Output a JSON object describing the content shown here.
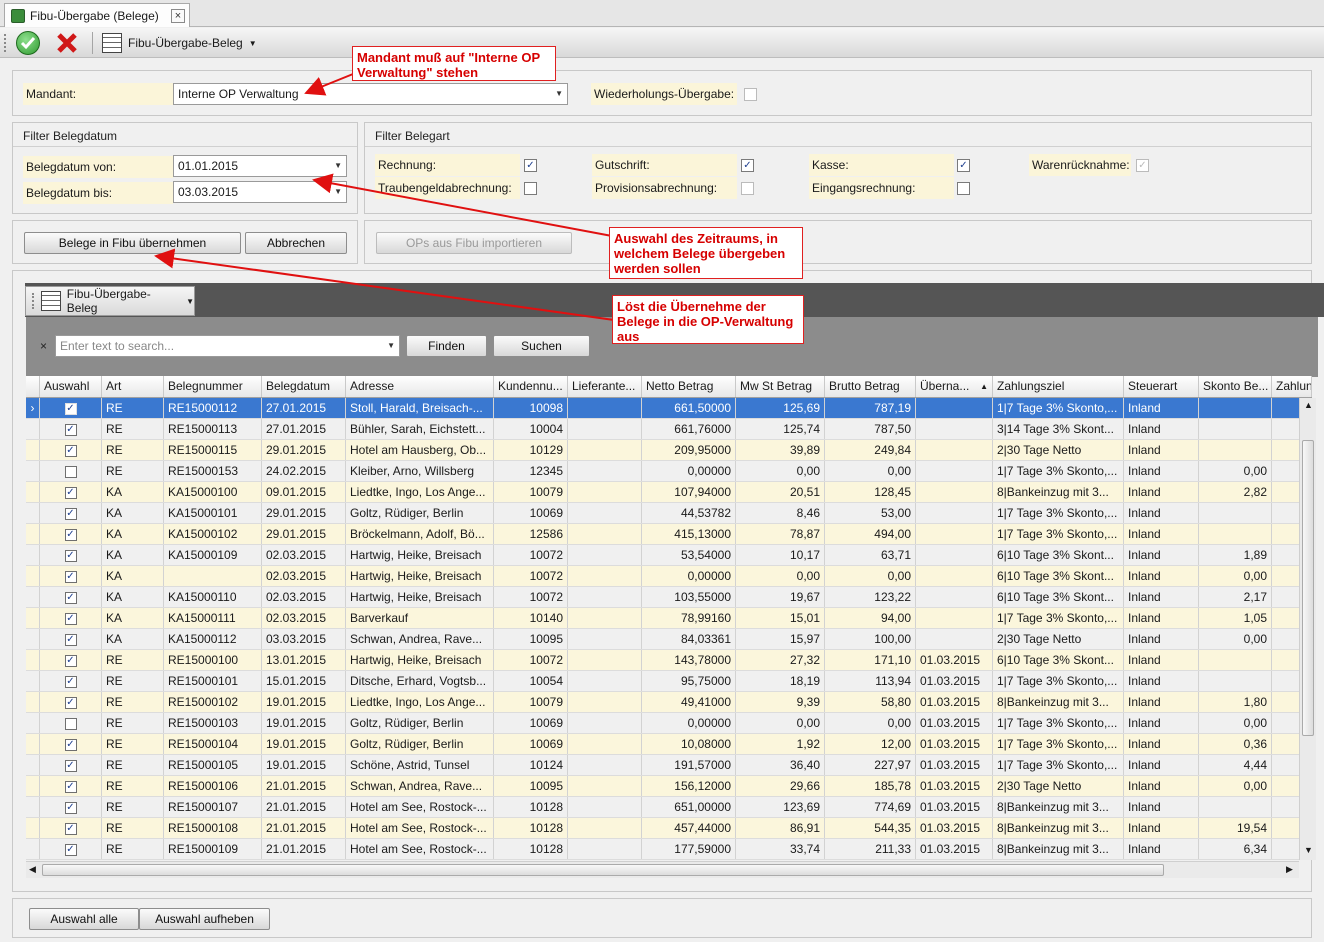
{
  "tab": {
    "title": "Fibu-Übergabe (Belege)",
    "close": "×"
  },
  "toolbar": {
    "report_label": "Fibu-Übergabe-Beleg"
  },
  "mandant": {
    "label": "Mandant:",
    "value": "Interne OP Verwaltung",
    "repeat_label": "Wiederholungs-Übergabe:"
  },
  "filter_date": {
    "title": "Filter Belegdatum",
    "from_label": "Belegdatum von:",
    "from_value": "01.01.2015",
    "to_label": "Belegdatum bis:",
    "to_value": "03.03.2015"
  },
  "filter_type": {
    "title": "Filter Belegart",
    "items": [
      {
        "label": "Rechnung:",
        "checked": true,
        "enabled": true
      },
      {
        "label": "Gutschrift:",
        "checked": true,
        "enabled": true
      },
      {
        "label": "Kasse:",
        "checked": true,
        "enabled": true
      },
      {
        "label": "Warenrücknahme:",
        "checked": true,
        "enabled": false
      },
      {
        "label": "Traubengeldabrechnung:",
        "checked": false,
        "enabled": true
      },
      {
        "label": "Provisionsabrechnung:",
        "checked": false,
        "enabled": false
      },
      {
        "label": "Eingangsrechnung:",
        "checked": false,
        "enabled": true
      }
    ]
  },
  "actions": {
    "take_over": "Belege in Fibu übernehmen",
    "cancel": "Abbrechen",
    "import": "OPs aus Fibu importieren"
  },
  "grid_toolbar": {
    "label": "Fibu-Übergabe-Beleg"
  },
  "search": {
    "placeholder": "Enter text to search...",
    "find": "Finden",
    "search": "Suchen"
  },
  "callouts": {
    "mandant": "Mandant muß auf \"Interne OP Verwaltung\" stehen",
    "period": "Auswahl des Zeitraums, in welchem Belege übergeben werden sollen",
    "takeover": "Löst die Übernehme der Belege in die OP-Verwaltung aus"
  },
  "columns": [
    "Auswahl",
    "Art",
    "Belegnummer",
    "Belegdatum",
    "Adresse",
    "Kundennu...",
    "Lieferante...",
    "Netto Betrag",
    "Mw St Betrag",
    "Brutto Betrag",
    "Überna...",
    "Zahlungsziel",
    "Steuerart",
    "Skonto Be...",
    "Zahlun"
  ],
  "rows": [
    {
      "checked": true,
      "art": "RE",
      "nr": "RE15000112",
      "datum": "27.01.2015",
      "adresse": "Stoll, Harald, Breisach-...",
      "kunde": "10098",
      "netto": "661,50000",
      "mwst": "125,69",
      "brutto": "787,19",
      "ueber": "",
      "ziel": "1|7 Tage 3% Skonto,...",
      "steuer": "Inland",
      "skonto": ""
    },
    {
      "checked": true,
      "art": "RE",
      "nr": "RE15000113",
      "datum": "27.01.2015",
      "adresse": "Bühler, Sarah, Eichstett...",
      "kunde": "10004",
      "netto": "661,76000",
      "mwst": "125,74",
      "brutto": "787,50",
      "ueber": "",
      "ziel": "3|14 Tage 3% Skont...",
      "steuer": "Inland",
      "skonto": ""
    },
    {
      "checked": true,
      "art": "RE",
      "nr": "RE15000115",
      "datum": "29.01.2015",
      "adresse": "Hotel am Hausberg, Ob...",
      "kunde": "10129",
      "netto": "209,95000",
      "mwst": "39,89",
      "brutto": "249,84",
      "ueber": "",
      "ziel": "2|30 Tage Netto",
      "steuer": "Inland",
      "skonto": ""
    },
    {
      "checked": false,
      "art": "RE",
      "nr": "RE15000153",
      "datum": "24.02.2015",
      "adresse": "Kleiber, Arno, Willsberg",
      "kunde": "12345",
      "netto": "0,00000",
      "mwst": "0,00",
      "brutto": "0,00",
      "ueber": "",
      "ziel": "1|7 Tage 3% Skonto,...",
      "steuer": "Inland",
      "skonto": "0,00"
    },
    {
      "checked": true,
      "art": "KA",
      "nr": "KA15000100",
      "datum": "09.01.2015",
      "adresse": "Liedtke, Ingo, Los Ange...",
      "kunde": "10079",
      "netto": "107,94000",
      "mwst": "20,51",
      "brutto": "128,45",
      "ueber": "",
      "ziel": "8|Bankeinzug mit 3...",
      "steuer": "Inland",
      "skonto": "2,82"
    },
    {
      "checked": true,
      "art": "KA",
      "nr": "KA15000101",
      "datum": "29.01.2015",
      "adresse": "Goltz, Rüdiger, Berlin",
      "kunde": "10069",
      "netto": "44,53782",
      "mwst": "8,46",
      "brutto": "53,00",
      "ueber": "",
      "ziel": "1|7 Tage 3% Skonto,...",
      "steuer": "Inland",
      "skonto": ""
    },
    {
      "checked": true,
      "art": "KA",
      "nr": "KA15000102",
      "datum": "29.01.2015",
      "adresse": "Bröckelmann, Adolf, Bö...",
      "kunde": "12586",
      "netto": "415,13000",
      "mwst": "78,87",
      "brutto": "494,00",
      "ueber": "",
      "ziel": "1|7 Tage 3% Skonto,...",
      "steuer": "Inland",
      "skonto": ""
    },
    {
      "checked": true,
      "art": "KA",
      "nr": "KA15000109",
      "datum": "02.03.2015",
      "adresse": "Hartwig, Heike, Breisach",
      "kunde": "10072",
      "netto": "53,54000",
      "mwst": "10,17",
      "brutto": "63,71",
      "ueber": "",
      "ziel": "6|10 Tage 3% Skont...",
      "steuer": "Inland",
      "skonto": "1,89"
    },
    {
      "checked": true,
      "art": "KA",
      "nr": "",
      "datum": "02.03.2015",
      "adresse": "Hartwig, Heike, Breisach",
      "kunde": "10072",
      "netto": "0,00000",
      "mwst": "0,00",
      "brutto": "0,00",
      "ueber": "",
      "ziel": "6|10 Tage 3% Skont...",
      "steuer": "Inland",
      "skonto": "0,00"
    },
    {
      "checked": true,
      "art": "KA",
      "nr": "KA15000110",
      "datum": "02.03.2015",
      "adresse": "Hartwig, Heike, Breisach",
      "kunde": "10072",
      "netto": "103,55000",
      "mwst": "19,67",
      "brutto": "123,22",
      "ueber": "",
      "ziel": "6|10 Tage 3% Skont...",
      "steuer": "Inland",
      "skonto": "2,17"
    },
    {
      "checked": true,
      "art": "KA",
      "nr": "KA15000111",
      "datum": "02.03.2015",
      "adresse": "Barverkauf",
      "kunde": "10140",
      "netto": "78,99160",
      "mwst": "15,01",
      "brutto": "94,00",
      "ueber": "",
      "ziel": "1|7 Tage 3% Skonto,...",
      "steuer": "Inland",
      "skonto": "1,05"
    },
    {
      "checked": true,
      "art": "KA",
      "nr": "KA15000112",
      "datum": "03.03.2015",
      "adresse": "Schwan, Andrea, Rave...",
      "kunde": "10095",
      "netto": "84,03361",
      "mwst": "15,97",
      "brutto": "100,00",
      "ueber": "",
      "ziel": "2|30 Tage Netto",
      "steuer": "Inland",
      "skonto": "0,00"
    },
    {
      "checked": true,
      "art": "RE",
      "nr": "RE15000100",
      "datum": "13.01.2015",
      "adresse": "Hartwig, Heike, Breisach",
      "kunde": "10072",
      "netto": "143,78000",
      "mwst": "27,32",
      "brutto": "171,10",
      "ueber": "01.03.2015",
      "ziel": "6|10 Tage 3% Skont...",
      "steuer": "Inland",
      "skonto": ""
    },
    {
      "checked": true,
      "art": "RE",
      "nr": "RE15000101",
      "datum": "15.01.2015",
      "adresse": "Ditsche, Erhard, Vogtsb...",
      "kunde": "10054",
      "netto": "95,75000",
      "mwst": "18,19",
      "brutto": "113,94",
      "ueber": "01.03.2015",
      "ziel": "1|7 Tage 3% Skonto,...",
      "steuer": "Inland",
      "skonto": ""
    },
    {
      "checked": true,
      "art": "RE",
      "nr": "RE15000102",
      "datum": "19.01.2015",
      "adresse": "Liedtke, Ingo, Los Ange...",
      "kunde": "10079",
      "netto": "49,41000",
      "mwst": "9,39",
      "brutto": "58,80",
      "ueber": "01.03.2015",
      "ziel": "8|Bankeinzug mit 3...",
      "steuer": "Inland",
      "skonto": "1,80"
    },
    {
      "checked": false,
      "art": "RE",
      "nr": "RE15000103",
      "datum": "19.01.2015",
      "adresse": "Goltz, Rüdiger, Berlin",
      "kunde": "10069",
      "netto": "0,00000",
      "mwst": "0,00",
      "brutto": "0,00",
      "ueber": "01.03.2015",
      "ziel": "1|7 Tage 3% Skonto,...",
      "steuer": "Inland",
      "skonto": "0,00"
    },
    {
      "checked": true,
      "art": "RE",
      "nr": "RE15000104",
      "datum": "19.01.2015",
      "adresse": "Goltz, Rüdiger, Berlin",
      "kunde": "10069",
      "netto": "10,08000",
      "mwst": "1,92",
      "brutto": "12,00",
      "ueber": "01.03.2015",
      "ziel": "1|7 Tage 3% Skonto,...",
      "steuer": "Inland",
      "skonto": "0,36"
    },
    {
      "checked": true,
      "art": "RE",
      "nr": "RE15000105",
      "datum": "19.01.2015",
      "adresse": "Schöne, Astrid, Tunsel",
      "kunde": "10124",
      "netto": "191,57000",
      "mwst": "36,40",
      "brutto": "227,97",
      "ueber": "01.03.2015",
      "ziel": "1|7 Tage 3% Skonto,...",
      "steuer": "Inland",
      "skonto": "4,44"
    },
    {
      "checked": true,
      "art": "RE",
      "nr": "RE15000106",
      "datum": "21.01.2015",
      "adresse": "Schwan, Andrea, Rave...",
      "kunde": "10095",
      "netto": "156,12000",
      "mwst": "29,66",
      "brutto": "185,78",
      "ueber": "01.03.2015",
      "ziel": "2|30 Tage Netto",
      "steuer": "Inland",
      "skonto": "0,00"
    },
    {
      "checked": true,
      "art": "RE",
      "nr": "RE15000107",
      "datum": "21.01.2015",
      "adresse": "Hotel am See, Rostock-...",
      "kunde": "10128",
      "netto": "651,00000",
      "mwst": "123,69",
      "brutto": "774,69",
      "ueber": "01.03.2015",
      "ziel": "8|Bankeinzug mit 3...",
      "steuer": "Inland",
      "skonto": ""
    },
    {
      "checked": true,
      "art": "RE",
      "nr": "RE15000108",
      "datum": "21.01.2015",
      "adresse": "Hotel am See, Rostock-...",
      "kunde": "10128",
      "netto": "457,44000",
      "mwst": "86,91",
      "brutto": "544,35",
      "ueber": "01.03.2015",
      "ziel": "8|Bankeinzug mit 3...",
      "steuer": "Inland",
      "skonto": "19,54"
    },
    {
      "checked": true,
      "art": "RE",
      "nr": "RE15000109",
      "datum": "21.01.2015",
      "adresse": "Hotel am See, Rostock-...",
      "kunde": "10128",
      "netto": "177,59000",
      "mwst": "33,74",
      "brutto": "211,33",
      "ueber": "01.03.2015",
      "ziel": "8|Bankeinzug mit 3...",
      "steuer": "Inland",
      "skonto": "6,34"
    }
  ],
  "footer": {
    "select_all": "Auswahl alle",
    "deselect": "Auswahl aufheben"
  }
}
